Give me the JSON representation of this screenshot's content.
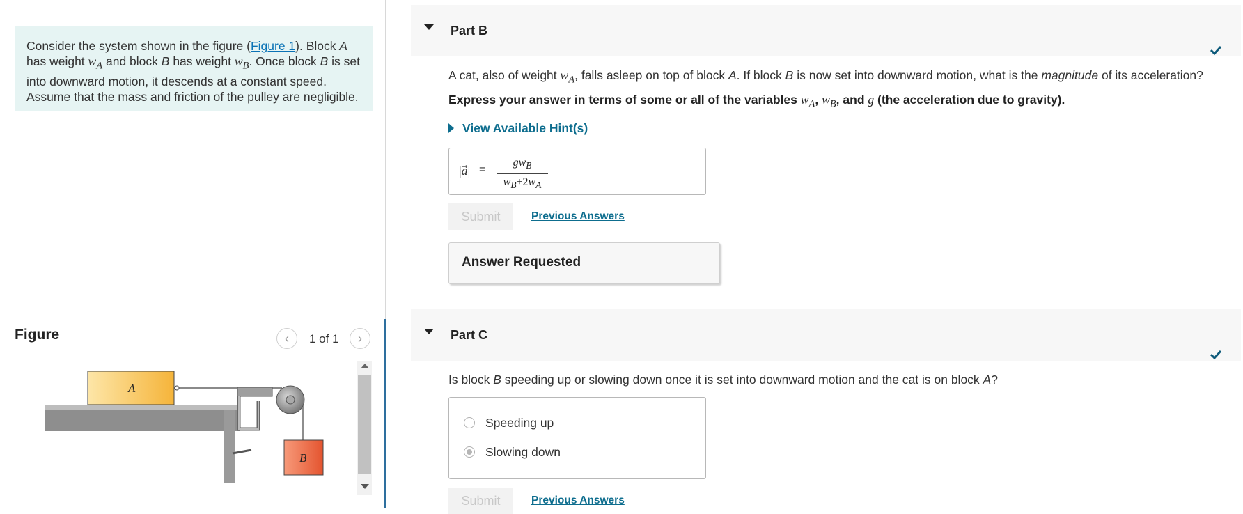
{
  "problem": {
    "text_parts": [
      "Consider the system shown in the figure (",
      "). Block ",
      " has weight ",
      " and block ",
      " has weight ",
      ". Once block ",
      " is set into downward motion, it descends at a constant speed. Assume that the mass and friction of the pulley are negligible."
    ],
    "figure_link": "Figure 1",
    "var_A": "A",
    "var_B": "B",
    "w_A": "wA",
    "w_B": "wB"
  },
  "figure": {
    "title": "Figure",
    "counter": "1 of 1",
    "prev_icon": "chevron-left-icon",
    "next_icon": "chevron-right-icon",
    "block_a_label": "A",
    "block_b_label": "B",
    "colors": {
      "block_a": "#f5b43a",
      "block_b": "#f0694a",
      "table": "#9a9a9a",
      "pulley": "#8c8c8c"
    }
  },
  "part_b": {
    "title": "Part B",
    "question": {
      "t1": "A cat, also of weight ",
      "w_A": "wA",
      "t2": ", falls asleep on top of block ",
      "A": "A",
      "t3": ". If block ",
      "B": "B",
      "t4": " is now set into downward motion, what is the ",
      "magnitude": "magnitude",
      "t5": " of its acceleration?"
    },
    "instruction": {
      "t1": "Express your answer in terms of some or all of the variables ",
      "w_A": "wA",
      "sep1": ", ",
      "w_B": "wB",
      "sep2": ", and ",
      "g": "g",
      "t2": " (the acceleration due to gravity)."
    },
    "hint_link": "View Available Hint(s)",
    "answer": {
      "lhs": "|a⃗|",
      "eq": "=",
      "numerator": "gwB",
      "denominator": "wB+2wA"
    },
    "submit_label": "Submit",
    "previous_answers": "Previous Answers",
    "answer_requested": "Answer Requested",
    "status_icon": "checkmark-icon"
  },
  "part_c": {
    "title": "Part C",
    "question": {
      "t1": "Is block ",
      "B": "B",
      "t2": " speeding up or slowing down once it is set into downward motion and the cat is on block ",
      "A": "A",
      "t3": "?"
    },
    "options": [
      "Speeding up",
      "Slowing down"
    ],
    "selected": "Slowing down",
    "submit_label": "Submit",
    "previous_answers": "Previous Answers",
    "status_icon": "checkmark-icon"
  },
  "colors": {
    "accent": "#0d6d8e",
    "link": "#0a72b5",
    "problem_bg": "#e6f4f3",
    "check": "#0d5a7a"
  }
}
